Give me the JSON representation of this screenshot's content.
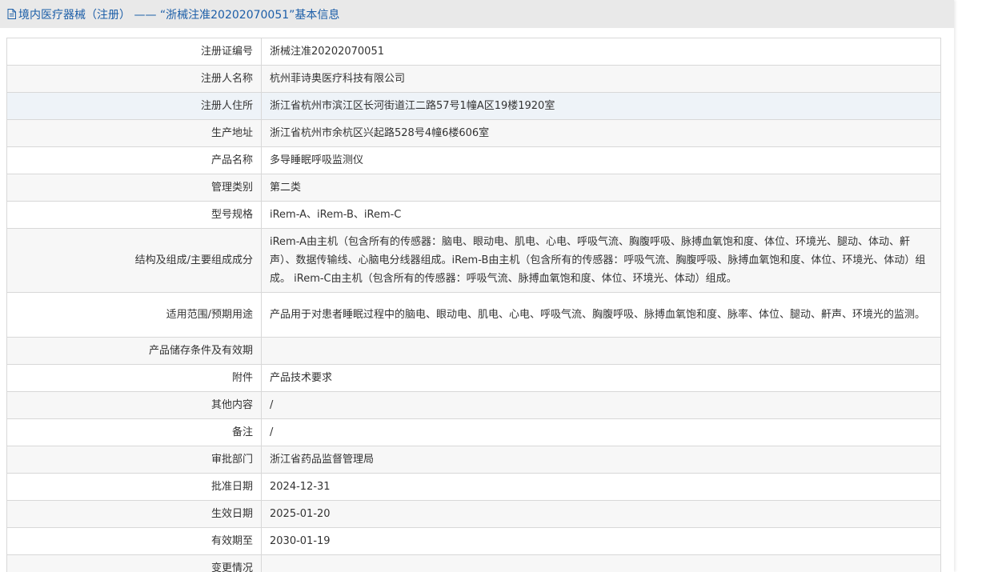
{
  "header": {
    "title": "境内医疗器械（注册） —— “浙械注准20202070051”基本信息",
    "icon": "document-icon",
    "color": "#1c5ea8"
  },
  "rows": [
    {
      "label": "注册证编号",
      "value": "浙械注准20202070051"
    },
    {
      "label": "注册人名称",
      "value": "杭州菲诗奥医疗科技有限公司"
    },
    {
      "label": "注册人住所",
      "value": "浙江省杭州市滨江区长河街道江二路57号1幢A区19楼1920室"
    },
    {
      "label": "生产地址",
      "value": "浙江省杭州市余杭区兴起路528号4幢6楼606室"
    },
    {
      "label": "产品名称",
      "value": "多导睡眠呼吸监测仪"
    },
    {
      "label": "管理类别",
      "value": "第二类"
    },
    {
      "label": "型号规格",
      "value": "iRem-A、iRem-B、iRem-C"
    },
    {
      "label": "结构及组成/主要组成成分",
      "value": "iRem-A由主机（包含所有的传感器：脑电、眼动电、肌电、心电、呼吸气流、胸腹呼吸、脉搏血氧饱和度、体位、环境光、腿动、体动、鼾声）、数据传输线、心脑电分线器组成。iRem-B由主机（包含所有的传感器：呼吸气流、胸腹呼吸、脉搏血氧饱和度、体位、环境光、体动）组成。 iRem-C由主机（包含所有的传感器：呼吸气流、脉搏血氧饱和度、体位、环境光、体动）组成。"
    },
    {
      "label": "适用范围/预期用途",
      "value": "产品用于对患者睡眠过程中的脑电、眼动电、肌电、心电、呼吸气流、胸腹呼吸、脉搏血氧饱和度、脉率、体位、腿动、鼾声、环境光的监测。"
    },
    {
      "label": "产品储存条件及有效期",
      "value": ""
    },
    {
      "label": "附件",
      "value": "产品技术要求"
    },
    {
      "label": "其他内容",
      "value": "/"
    },
    {
      "label": "备注",
      "value": "/"
    },
    {
      "label": "审批部门",
      "value": "浙江省药品监督管理局"
    },
    {
      "label": "批准日期",
      "value": "2024-12-31"
    },
    {
      "label": "生效日期",
      "value": "2025-01-20"
    },
    {
      "label": "有效期至",
      "value": "2030-01-19"
    },
    {
      "label": "变更情况",
      "value": ""
    }
  ]
}
